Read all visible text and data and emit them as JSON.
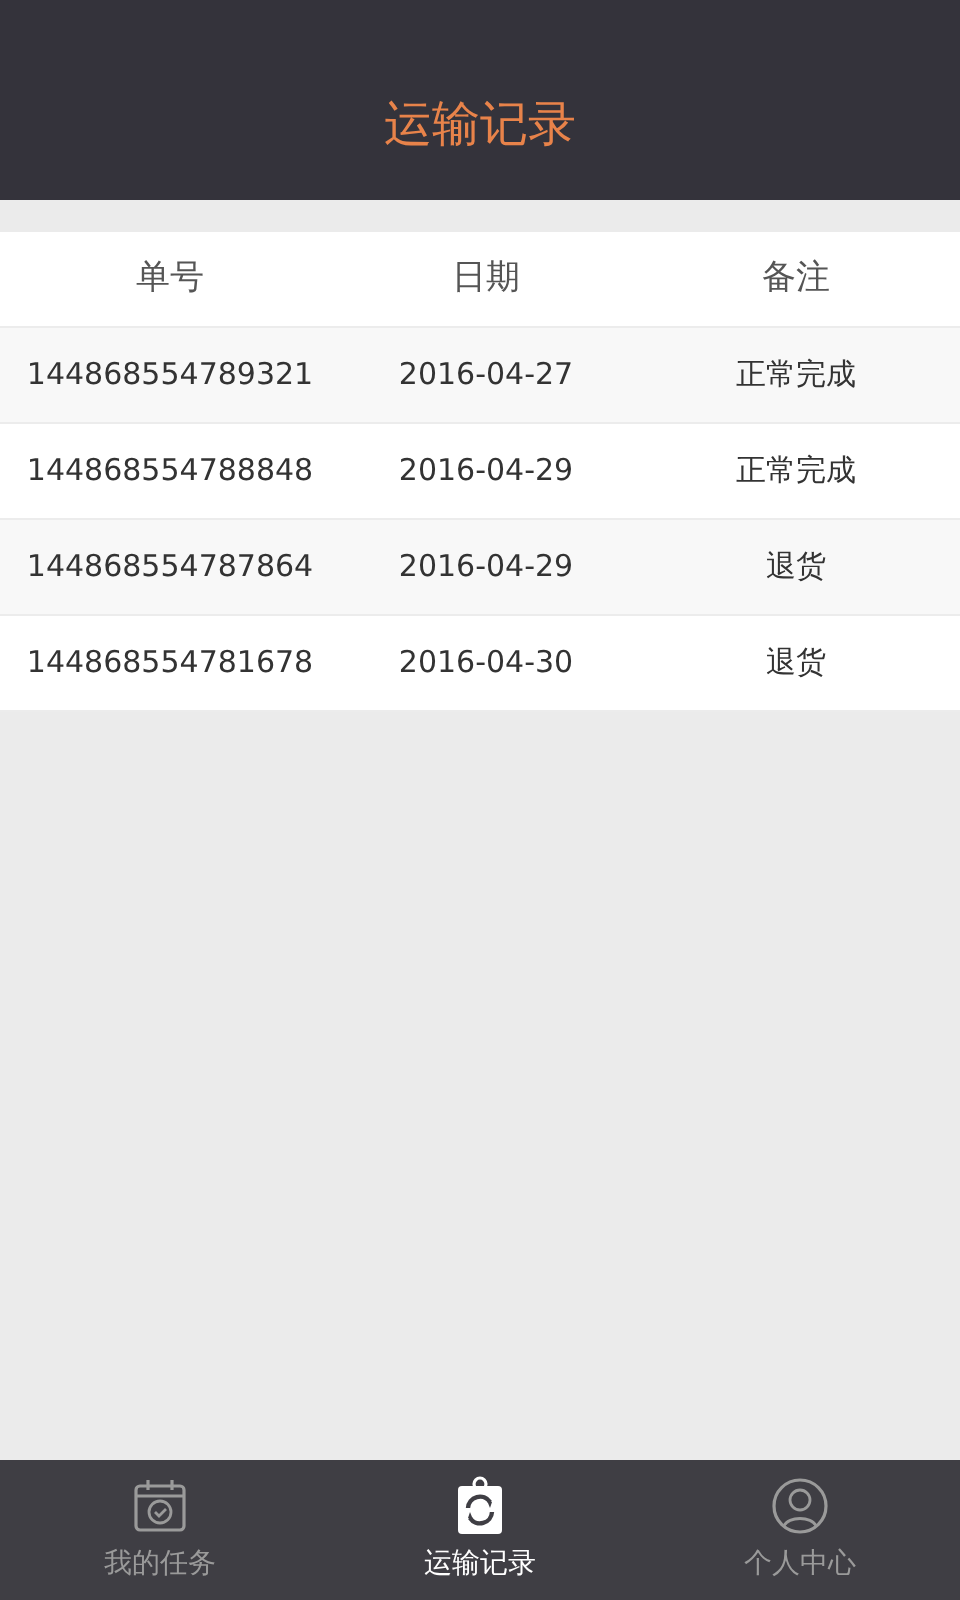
{
  "header": {
    "title": "运输记录"
  },
  "table": {
    "columns": [
      "单号",
      "日期",
      "备注"
    ],
    "rows": [
      {
        "cells": [
          "144868554789321",
          "2016-04-27",
          "正常完成"
        ]
      },
      {
        "cells": [
          "144868554788848",
          "2016-04-29",
          "正常完成"
        ]
      },
      {
        "cells": [
          "144868554787864",
          "2016-04-29",
          "退货"
        ]
      },
      {
        "cells": [
          "144868554781678",
          "2016-04-30",
          "退货"
        ]
      }
    ]
  },
  "tab_bar": [
    {
      "label": "我的任务",
      "kind": "calendar",
      "selected": false
    },
    {
      "label": "运输记录",
      "kind": "records",
      "selected": true
    },
    {
      "label": "个人中心",
      "kind": "person",
      "selected": false
    }
  ]
}
